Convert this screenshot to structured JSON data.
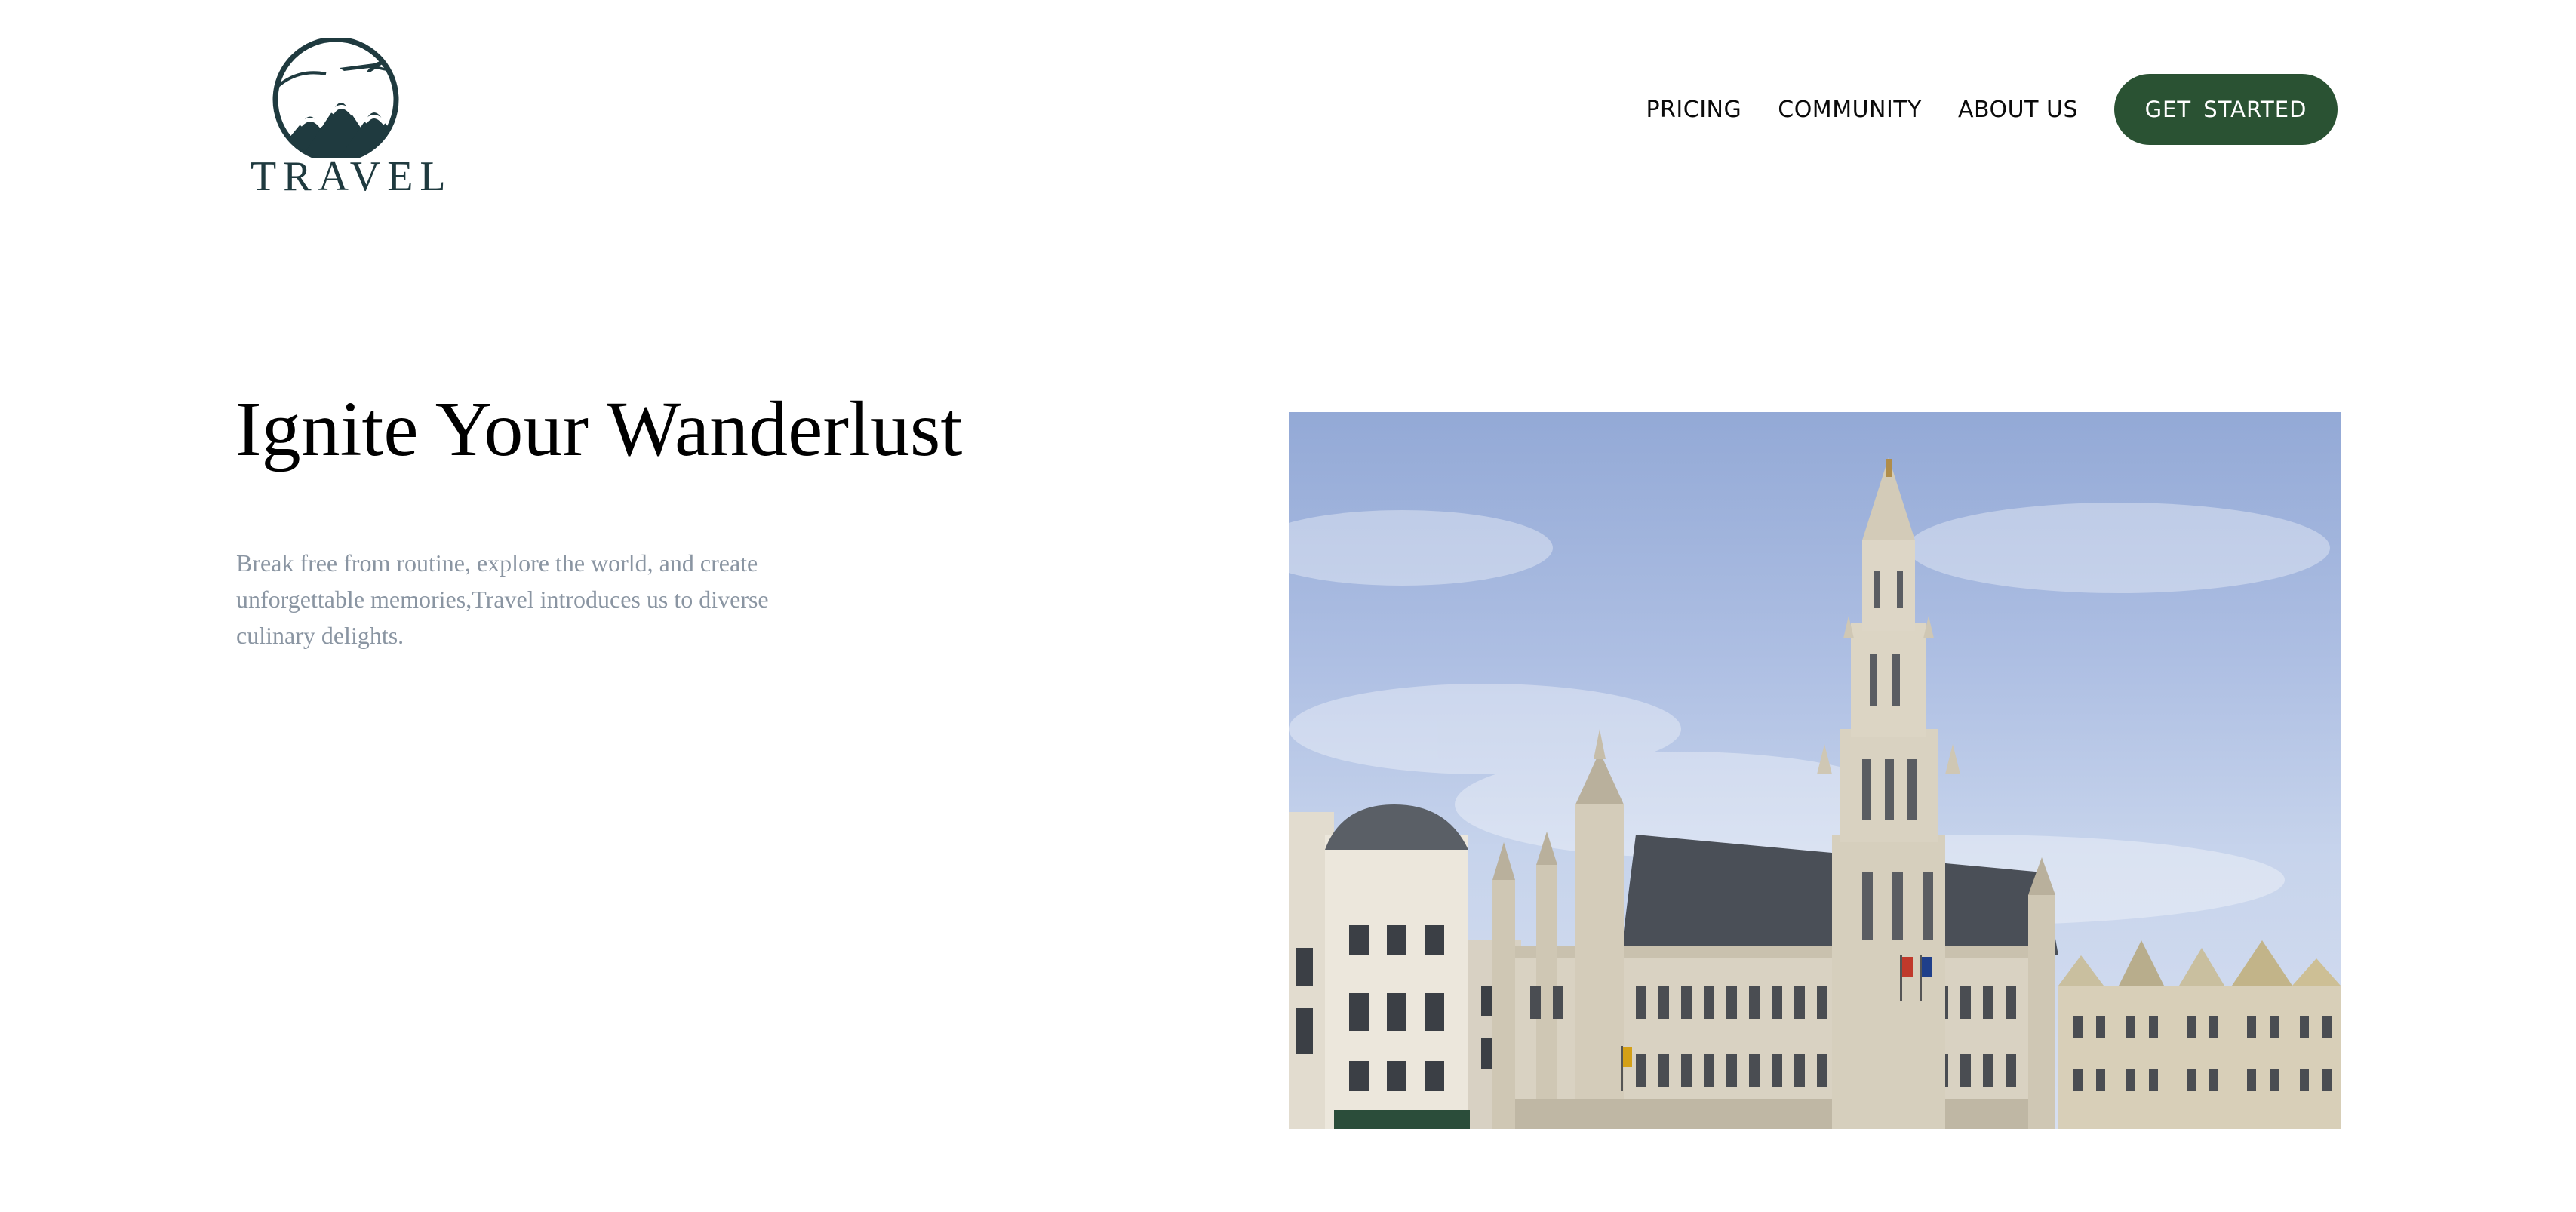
{
  "brand": {
    "name": "TRAVEL",
    "logo_icon": "mountain-airplane-icon",
    "color": "#1f3a3f"
  },
  "nav": {
    "links": [
      {
        "label": "PRICING"
      },
      {
        "label": "COMMUNITY"
      },
      {
        "label": "ABOUT US"
      }
    ],
    "cta_label": "GET  STARTED",
    "cta_color": "#2a5233"
  },
  "hero": {
    "title": "Ignite Your Wanderlust",
    "description": "Break free from routine, explore the world, and create unforgettable memories,Travel introduces us to diverse culinary delights.",
    "description_color": "#8a95a2",
    "image_subject": "gothic-town-hall-photo"
  }
}
